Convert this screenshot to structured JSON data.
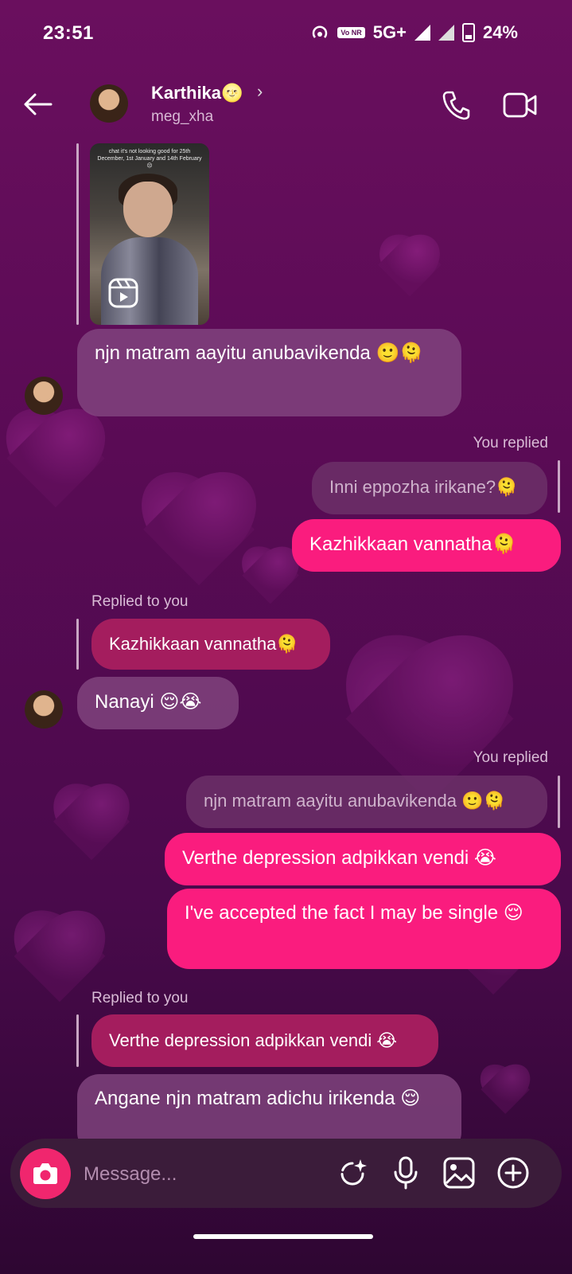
{
  "status": {
    "time": "23:51",
    "network": "5G+",
    "battery": "24%",
    "volte": "Vo NR"
  },
  "header": {
    "name": "Karthika🌝",
    "username": "meg_xha"
  },
  "reel": {
    "caption": "chat it's not looking good for 25th December, 1st January and 14th February 😔"
  },
  "messages": {
    "m1": "njn matram aayitu anubavikenda 🙂🫠",
    "you_replied_1": "You replied",
    "q1": "Inni eppozha irikane?🫠",
    "m2": "Kazhikkaan vannatha🫠",
    "replied_to_you_1": "Replied to you",
    "q2": "Kazhikkaan vannatha🫠",
    "m3": "Nanayi 😌😭",
    "you_replied_2": "You replied",
    "q3": "njn matram aayitu anubavikenda 🙂🫠",
    "m4": "Verthe depression adpikkan vendi 😭",
    "m5": "I've accepted the fact I may be single 😌",
    "replied_to_you_2": "Replied to you",
    "q4": "Verthe depression adpikkan vendi 😭",
    "m6": "Angane njn matram adichu irikenda 😌"
  },
  "composer": {
    "placeholder": "Message..."
  }
}
